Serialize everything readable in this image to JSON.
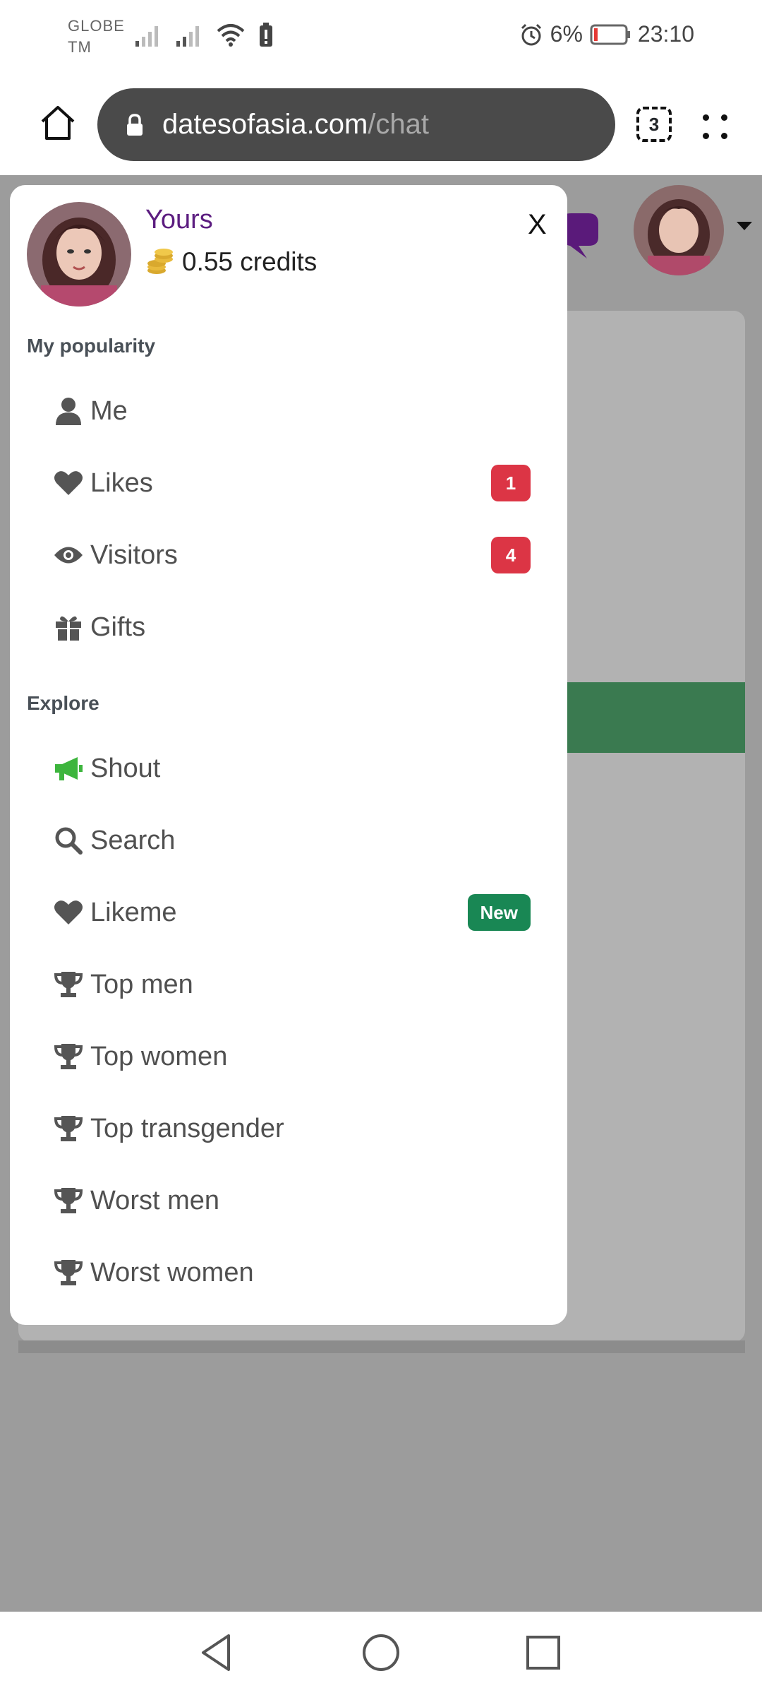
{
  "status_bar": {
    "carrier_line1": "GLOBE",
    "carrier_line2": "TM",
    "battery": "6%",
    "time": "23:10"
  },
  "browser": {
    "url_domain": "datesofasia.com",
    "url_path": "/chat",
    "tab_count": "3"
  },
  "drawer": {
    "user_name": "Yours",
    "credits": "0.55 credits",
    "close_label": "X",
    "sections": [
      {
        "title": "My popularity",
        "items": [
          {
            "label": "Me",
            "icon": "user-icon"
          },
          {
            "label": "Likes",
            "icon": "heart-icon",
            "badge": "1"
          },
          {
            "label": "Visitors",
            "icon": "eye-icon",
            "badge": "4"
          },
          {
            "label": "Gifts",
            "icon": "gift-icon"
          }
        ]
      },
      {
        "title": "Explore",
        "items": [
          {
            "label": "Shout",
            "icon": "megaphone-icon"
          },
          {
            "label": "Search",
            "icon": "search-icon"
          },
          {
            "label": "Likeme",
            "icon": "heart-icon",
            "badge": "New"
          },
          {
            "label": "Top men",
            "icon": "trophy-icon"
          },
          {
            "label": "Top women",
            "icon": "trophy-icon"
          },
          {
            "label": "Top transgender",
            "icon": "trophy-icon"
          },
          {
            "label": "Worst men",
            "icon": "trophy-icon"
          },
          {
            "label": "Worst women",
            "icon": "trophy-icon"
          }
        ]
      }
    ]
  },
  "colors": {
    "name": "#5c1d80",
    "badge_red": "#dc3545",
    "badge_green": "#198754",
    "shout_icon": "#3db53d",
    "coin": "#e0b23a"
  }
}
